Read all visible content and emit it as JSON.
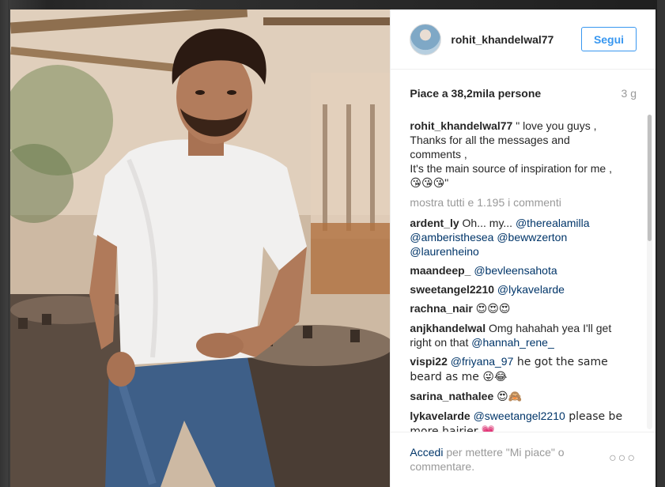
{
  "header": {
    "username": "rohit_khandelwal77",
    "follow_label": "Segui"
  },
  "post": {
    "likes": "Piace a 38,2mila persone",
    "time": "3 g"
  },
  "caption": {
    "user": "rohit_khandelwal77",
    "text": " \" love you guys , Thanks for all the messages and comments , It's the main source of inspiration for me , ",
    "line1": " \" love you guys ,",
    "line2": "Thanks for all the messages and",
    "line3": "comments ,",
    "line4": "It's the main source of inspiration for me ,",
    "emojis": "😘😘😘",
    "closing_quote": "\""
  },
  "view_all": "mostra tutti e 1.195 i commenti",
  "comments": [
    {
      "user": "ardent_ly",
      "text": "Oh... my...",
      "mentions": [
        "@therealamilla",
        "@amberisthesea",
        "@bewwzerton",
        "@laurenheino"
      ]
    },
    {
      "user": "maandeep_",
      "text": "",
      "mentions": [
        "@bevleensahota"
      ]
    },
    {
      "user": "sweetangel2210",
      "text": "",
      "mentions": [
        "@lykavelarde"
      ]
    },
    {
      "user": "rachna_nair",
      "text": "😍😍😍",
      "mentions": []
    },
    {
      "user": "anjkhandelwal",
      "text": "Omg hahahah yea I'll get right on that",
      "mentions": [
        "@hannah_rene_"
      ]
    },
    {
      "user": "vispi22",
      "text_after": " he got the same beard as me 😜😂",
      "mentions": [
        "@friyana_97"
      ]
    },
    {
      "user": "sarina_nathalee",
      "text": "😍🙈",
      "mentions": []
    },
    {
      "user": "lykavelarde",
      "text_after": " please be more hairier 💗",
      "mentions": [
        "@sweetangel2210"
      ]
    }
  ],
  "footer": {
    "login_link": "Accedi",
    "login_rest": " per mettere \"Mi piace\" o commentare.",
    "more_label": "○○○"
  },
  "colors": {
    "accent": "#3897f0",
    "mention": "#003569",
    "muted": "#999999",
    "text": "#262626"
  }
}
